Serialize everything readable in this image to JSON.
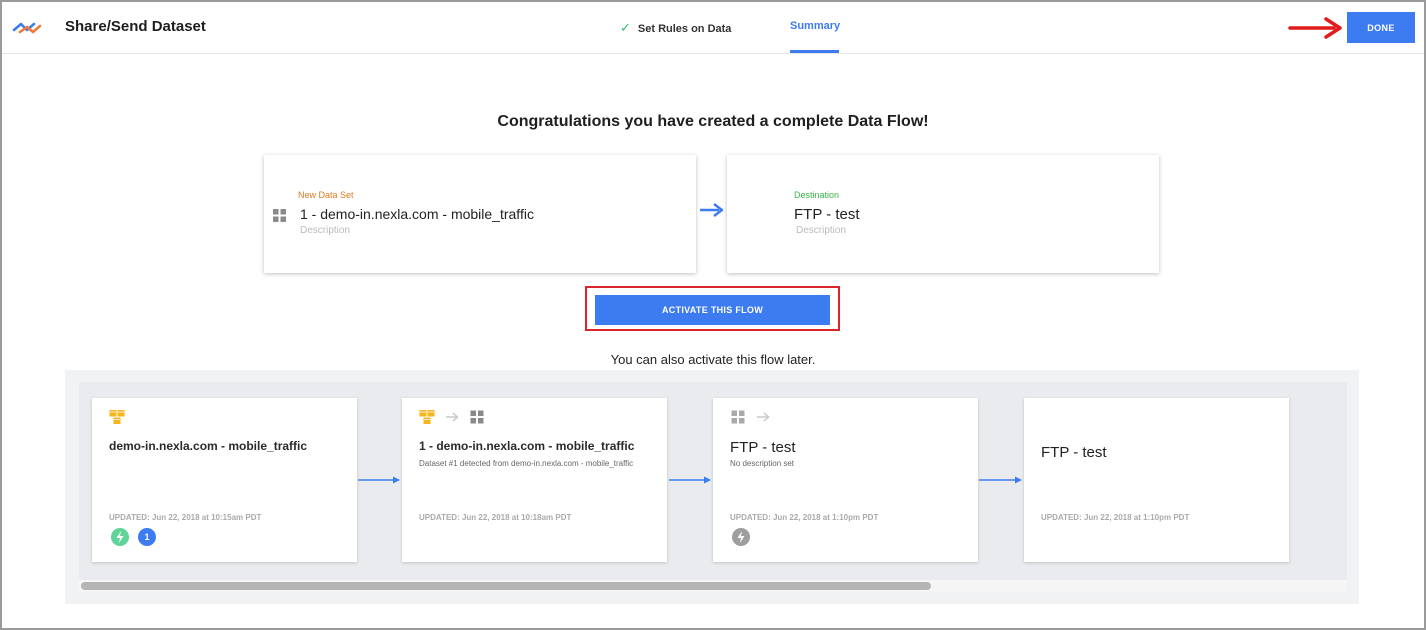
{
  "header": {
    "title": "Share/Send Dataset",
    "steps": [
      {
        "label": "Set Rules on Data",
        "state": "complete"
      },
      {
        "label": "Summary",
        "state": "active"
      }
    ],
    "done_label": "DONE"
  },
  "main": {
    "heading": "Congratulations you have created a complete Data Flow!",
    "source_card": {
      "kind": "New Data Set",
      "name": "1 - demo-in.nexla.com - mobile_traffic",
      "description_placeholder": "Description"
    },
    "destination_card": {
      "kind": "Destination",
      "name": "FTP - test",
      "description_placeholder": "Description"
    },
    "activate_label": "ACTIVATE THIS FLOW",
    "later_note": "You can also activate this flow later."
  },
  "flow": {
    "nodes": [
      {
        "title": "demo-in.nexla.com - mobile_traffic",
        "subtitle": "",
        "updated": "UPDATED: Jun 22, 2018 at 10:15am PDT",
        "badge_count": "1"
      },
      {
        "title": "1 - demo-in.nexla.com - mobile_traffic",
        "subtitle": "Dataset #1 detected from demo-in.nexla.com - mobile_traffic",
        "updated": "UPDATED: Jun 22, 2018 at 10:18am PDT"
      },
      {
        "title": "FTP - test",
        "subtitle": "No description set",
        "updated": "UPDATED: Jun 22, 2018 at 1:10pm PDT"
      },
      {
        "title": "FTP - test",
        "subtitle": "",
        "updated": "UPDATED: Jun 22, 2018 at 1:10pm PDT"
      }
    ]
  },
  "colors": {
    "accent": "#3d7cf0",
    "source_kind": "#e07a1f",
    "destination_kind": "#3bb54a",
    "highlight": "#d9252b",
    "active_badge": "#5fd39a",
    "inactive_badge": "#9e9e9e"
  },
  "icons": {
    "logo": "nexla-wave-logo",
    "check": "check-icon",
    "dataset": "grid-icon",
    "source": "cubes-icon",
    "arrow": "arrow-right-icon",
    "status": "lightning-icon"
  }
}
